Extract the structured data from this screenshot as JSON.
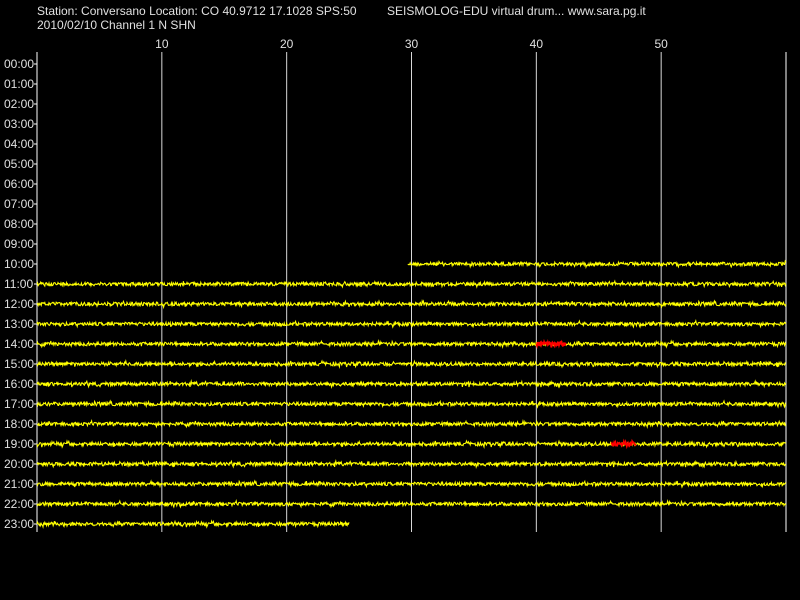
{
  "header": {
    "station_line": "Station: Conversano Location: CO 40.9712 17.1028 SPS:50",
    "app_line": "SEISMOLOG-EDU virtual drum... www.sara.pg.it",
    "date_line": "2010/02/10  Channel 1 N SHN"
  },
  "colors": {
    "background": "#000000",
    "trace": "#ffff00",
    "event": "#ff0000",
    "grid": "#ffffff",
    "text": "#e0e0e0"
  },
  "chart_data": {
    "type": "line",
    "title": "",
    "xlabel": "",
    "ylabel": "",
    "xlim": [
      0,
      60
    ],
    "x_ticks": [
      10,
      20,
      30,
      40,
      50
    ],
    "y_ticks": [
      "00:00",
      "01:00",
      "02:00",
      "03:00",
      "04:00",
      "05:00",
      "06:00",
      "07:00",
      "08:00",
      "09:00",
      "10:00",
      "11:00",
      "12:00",
      "13:00",
      "14:00",
      "15:00",
      "16:00",
      "17:00",
      "18:00",
      "19:00",
      "20:00",
      "21:00",
      "22:00",
      "23:00"
    ],
    "grid": true,
    "traces": [
      {
        "hour": "10:00",
        "start_min": 29.7,
        "end_min": 60
      },
      {
        "hour": "11:00",
        "start_min": 0,
        "end_min": 60
      },
      {
        "hour": "12:00",
        "start_min": 0,
        "end_min": 60
      },
      {
        "hour": "13:00",
        "start_min": 0,
        "end_min": 60
      },
      {
        "hour": "14:00",
        "start_min": 0,
        "end_min": 60
      },
      {
        "hour": "15:00",
        "start_min": 0,
        "end_min": 60
      },
      {
        "hour": "16:00",
        "start_min": 0,
        "end_min": 60
      },
      {
        "hour": "17:00",
        "start_min": 0,
        "end_min": 60
      },
      {
        "hour": "18:00",
        "start_min": 0,
        "end_min": 60
      },
      {
        "hour": "19:00",
        "start_min": 0,
        "end_min": 60
      },
      {
        "hour": "20:00",
        "start_min": 0,
        "end_min": 60
      },
      {
        "hour": "21:00",
        "start_min": 0,
        "end_min": 60
      },
      {
        "hour": "22:00",
        "start_min": 0,
        "end_min": 60
      },
      {
        "hour": "23:00",
        "start_min": 0,
        "end_min": 25
      }
    ],
    "events": [
      {
        "hour": "14:00",
        "start_min": 40,
        "end_min": 42.4
      },
      {
        "hour": "19:00",
        "start_min": 46,
        "end_min": 48
      }
    ]
  }
}
